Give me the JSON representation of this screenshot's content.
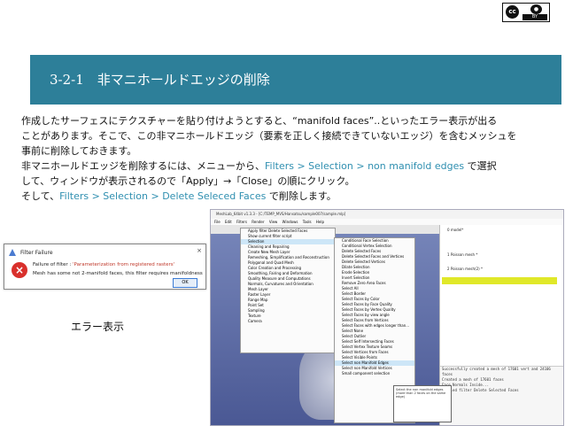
{
  "license": {
    "by_label": "BY",
    "cc_label": "cc"
  },
  "banner": {
    "title": "3-2-1　非マニホールドエッジの削除",
    "color": "#2d7f99"
  },
  "body": {
    "line1": "作成したサーフェスにテクスチャーを貼り付けようとすると、“manifold faces”..といったエラー表示が出る",
    "line2": "ことがあります。そこで、この非マニホールドエッジ（要素を正しく接続できていないエッジ）を含むメッシュを",
    "line3": "事前に削除しておきます。",
    "line4a": "非マニホールドエッジを削除するには、メニューから、",
    "line4b": "Filters > Selection > non manifold edges",
    "line4c": " で選択",
    "line5": "して、ウィンドウが表示されるので「Apply」→「Close」の順にクリック。",
    "line6a": "そして、",
    "line6b": "Filters > Selection > Delete Seleced Faces",
    "line6c": " で削除します。",
    "highlight_color": "#2f8fb0"
  },
  "screenshot": {
    "title": "MeshLab_64bit v1.3.3 - [C:/TEMP_MVS/Hansatsu/sample007/sample.mlp]",
    "menus": [
      "File",
      "Edit",
      "Filters",
      "Render",
      "View",
      "Windows",
      "Tools",
      "Help"
    ],
    "filters_menu": [
      "Apply filter Delete Selected Faces",
      "Show current filter script",
      "Selection",
      "Cleaning and Repairing",
      "Create New Mesh Layer",
      "Remeshing, Simplification and Reconstruction",
      "Polygonal and Quad Mesh",
      "Color Creation and Processing",
      "Smoothing, Fairing and Deformation",
      "Quality Measure and Computations",
      "Normals, Curvatures and Orientation",
      "Mesh Layer",
      "Raster Layer",
      "Range Map",
      "Point Set",
      "Sampling",
      "Texture",
      "Camera"
    ],
    "selection_menu": [
      "Conditional Face Selection",
      "Conditional Vertex Selection",
      "Delete Selected Faces",
      "Delete Selected Faces and Vertices",
      "Delete Selected Vertices",
      "Dilate Selection",
      "Erode Selection",
      "Invert Selection",
      "Remove Zero Area Faces",
      "Select All",
      "Select Border",
      "Select Faces by Color",
      "Select Faces by Face Quality",
      "Select Faces by Vertex Quality",
      "Select Faces by view angle",
      "Select Faces from Vertices",
      "Select Faces with edges longer than...",
      "Select None",
      "Select Outlier",
      "Select Self Intersecting Faces",
      "Select Vertex Texture Seams",
      "Select Vertices from Faces",
      "Select Visible Points",
      "Select non Manifold Edges",
      "Select non Manifold Vertices",
      "Small component selection"
    ],
    "tooltip": "Select the non manifold edges (more than 2 faces on the same edge)",
    "layers": [
      "0 model*",
      "1 Poisson mesh *",
      "2 Poisson mesh(2) *"
    ],
    "log": [
      "Successfully created a mesh of 17601 vert and 24106 faces",
      "Created a mesh of 17601 faces",
      "Face Normals Inside...",
      "Applied filter Delete Selected Faces"
    ]
  },
  "dialog": {
    "title": "Filter Failure",
    "close_glyph": "×",
    "message_prefix": "Failure of filter : ",
    "message_filter": "'Parameterization from registered rasters'",
    "message_detail": "Mesh has some not 2-manifold faces, this filter requires manifoldness",
    "ok_label": "OK"
  },
  "caption": "エラー表示"
}
